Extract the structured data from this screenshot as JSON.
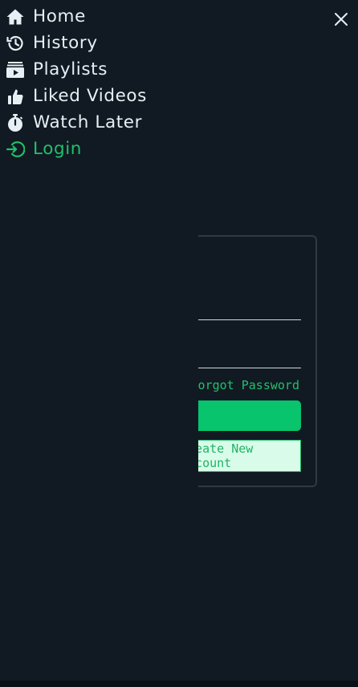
{
  "nav": {
    "items": [
      {
        "label": "Home",
        "icon": "home-icon"
      },
      {
        "label": "History",
        "icon": "history-icon"
      },
      {
        "label": "Playlists",
        "icon": "playlist-icon"
      },
      {
        "label": "Liked Videos",
        "icon": "thumbs-up-icon"
      },
      {
        "label": "Watch Later",
        "icon": "stopwatch-icon"
      },
      {
        "label": "Login",
        "icon": "login-icon"
      }
    ],
    "active_index": 5,
    "close_icon": "close-icon"
  },
  "login_card": {
    "title": "",
    "email_value": "",
    "password_value": "",
    "forgot_label": "Forgot Password",
    "login_button_label": "",
    "create_account_label": "Create New Account"
  },
  "colors": {
    "background": "#111a22",
    "accent": "#07c46d",
    "accent_text": "#21c06b",
    "text": "#e7eef4",
    "secondary_button_bg": "#d9fcea"
  }
}
